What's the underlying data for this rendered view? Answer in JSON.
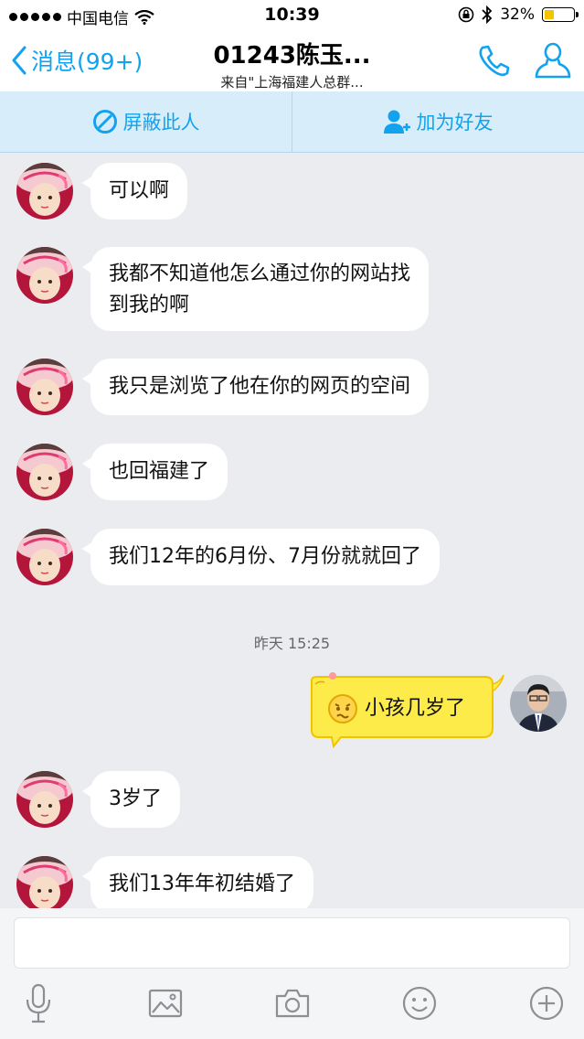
{
  "status_bar": {
    "carrier": "中国电信",
    "time": "10:39",
    "battery": "32%"
  },
  "nav": {
    "back_label": "消息(99+)",
    "title": "01243陈玉...",
    "subtitle": "来自\"上海福建人总群..."
  },
  "actions": {
    "block": "屏蔽此人",
    "add_friend": "加为好友"
  },
  "messages": [
    {
      "text": "可以啊"
    },
    {
      "text": "我都不知道他怎么通过你的网站找",
      "text2": "到我的啊"
    },
    {
      "text": "我只是浏览了他在你的网页的空间"
    },
    {
      "text": "也回福建了"
    },
    {
      "text": "我们12年的6月份、7月份就就回了"
    },
    {
      "text": "小孩几岁了"
    },
    {
      "text": "3岁了"
    },
    {
      "text": "我们13年年初结婚了"
    }
  ],
  "timestamp": "昨天 15:25",
  "colors": {
    "accent": "#12a3ee",
    "chat_bg": "#ebecf0",
    "action_bar": "#d7edfa",
    "sent_bubble": "#fdeb4a"
  },
  "toolbar_icons": [
    "microphone-icon",
    "image-icon",
    "camera-icon",
    "emoji-icon",
    "plus-icon"
  ]
}
